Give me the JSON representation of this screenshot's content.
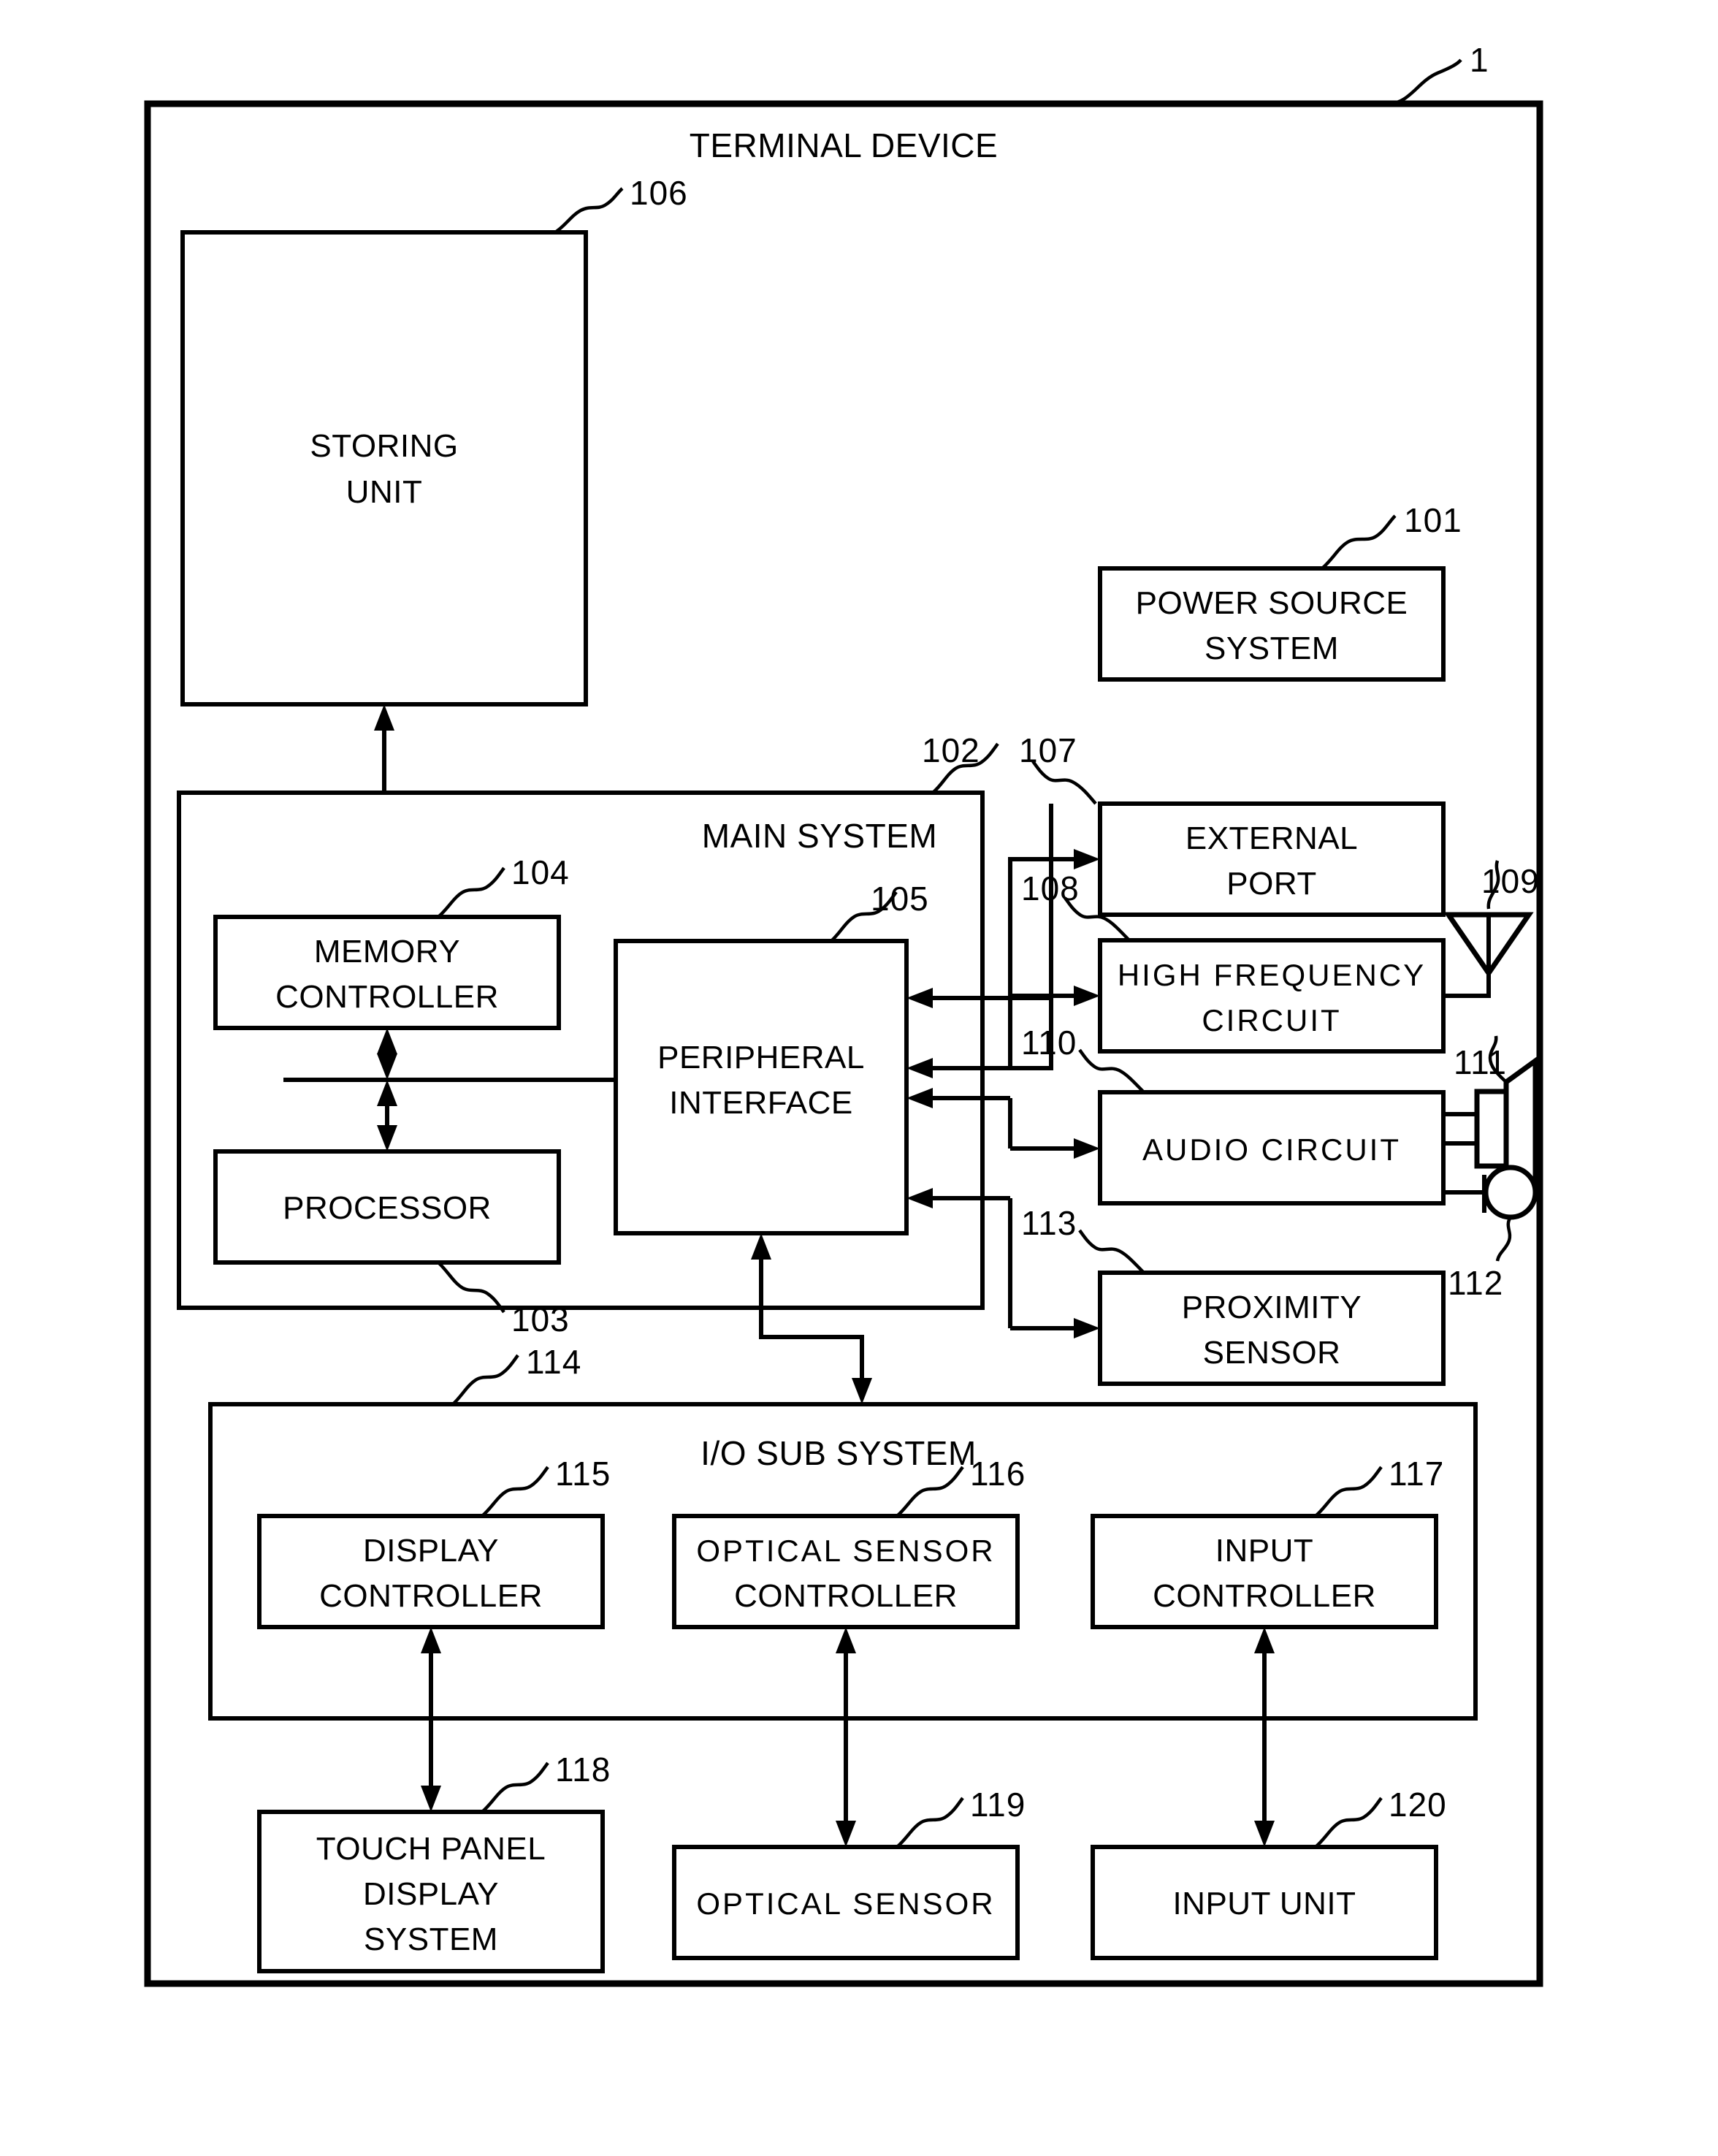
{
  "figure": {
    "root_ref": "1",
    "title": "TERMINAL DEVICE"
  },
  "groups": {
    "main_system": {
      "label": "MAIN SYSTEM",
      "ref": "102"
    },
    "io_sub_system": {
      "label": "I/O SUB SYSTEM",
      "ref": "114"
    }
  },
  "blocks": {
    "storing_unit": {
      "line1": "STORING",
      "line2": "UNIT",
      "ref": "106"
    },
    "power_source_system": {
      "line1": "POWER SOURCE",
      "line2": "SYSTEM",
      "ref": "101"
    },
    "memory_controller": {
      "line1": "MEMORY",
      "line2": "CONTROLLER",
      "ref": "104"
    },
    "processor": {
      "line1": "PROCESSOR",
      "line2": "",
      "ref": "103"
    },
    "peripheral_interface": {
      "line1": "PERIPHERAL",
      "line2": "INTERFACE",
      "ref": "105"
    },
    "external_port": {
      "line1": "EXTERNAL",
      "line2": "PORT",
      "ref": "107"
    },
    "high_frequency_circuit": {
      "line1": "HIGH FREQUENCY",
      "line2": "CIRCUIT",
      "ref": "108"
    },
    "audio_circuit": {
      "line1": "AUDIO CIRCUIT",
      "line2": "",
      "ref": "110"
    },
    "proximity_sensor": {
      "line1": "PROXIMITY",
      "line2": "SENSOR",
      "ref": "113"
    },
    "display_controller": {
      "line1": "DISPLAY",
      "line2": "CONTROLLER",
      "ref": "115"
    },
    "optical_sensor_controller": {
      "line1": "OPTICAL SENSOR",
      "line2": "CONTROLLER",
      "ref": "116"
    },
    "input_controller": {
      "line1": "INPUT",
      "line2": "CONTROLLER",
      "ref": "117"
    },
    "touch_panel_display_system": {
      "line1": "TOUCH PANEL",
      "line2": "DISPLAY",
      "line3": "SYSTEM",
      "ref": "118"
    },
    "optical_sensor": {
      "line1": "OPTICAL SENSOR",
      "line2": "",
      "ref": "119"
    },
    "input_unit": {
      "line1": "INPUT UNIT",
      "line2": "",
      "ref": "120"
    }
  },
  "icons": {
    "antenna": {
      "name": "antenna-icon",
      "ref": "109"
    },
    "speaker": {
      "name": "speaker-icon",
      "ref": "111"
    },
    "microphone": {
      "name": "microphone-icon",
      "ref": "112"
    }
  }
}
